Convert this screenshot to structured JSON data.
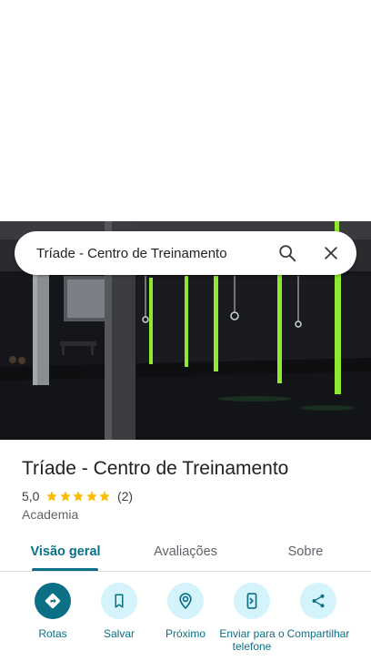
{
  "search": {
    "query": "Tríade - Centro de Treinamento",
    "search_icon": "search-icon",
    "close_icon": "close-icon"
  },
  "place": {
    "name": "Tríade - Centro de Treinamento",
    "rating": "5,0",
    "rating_value": 5.0,
    "review_count": "(2)",
    "category": "Academia",
    "star_color": "#fbbc04"
  },
  "tabs": [
    {
      "label": "Visão geral",
      "active": true
    },
    {
      "label": "Avaliações",
      "active": false
    },
    {
      "label": "Sobre",
      "active": false
    }
  ],
  "actions": [
    {
      "label": "Rotas",
      "icon": "directions-icon"
    },
    {
      "label": "Salvar",
      "icon": "bookmark-icon"
    },
    {
      "label": "Próximo",
      "icon": "nearby-icon"
    },
    {
      "label": "Enviar para o telefone",
      "icon": "send-to-phone-icon"
    },
    {
      "label": "Compartilhar",
      "icon": "share-icon"
    }
  ],
  "colors": {
    "accent": "#0b6f85",
    "action_bg": "#d4f3fb",
    "star": "#fbbc04"
  }
}
